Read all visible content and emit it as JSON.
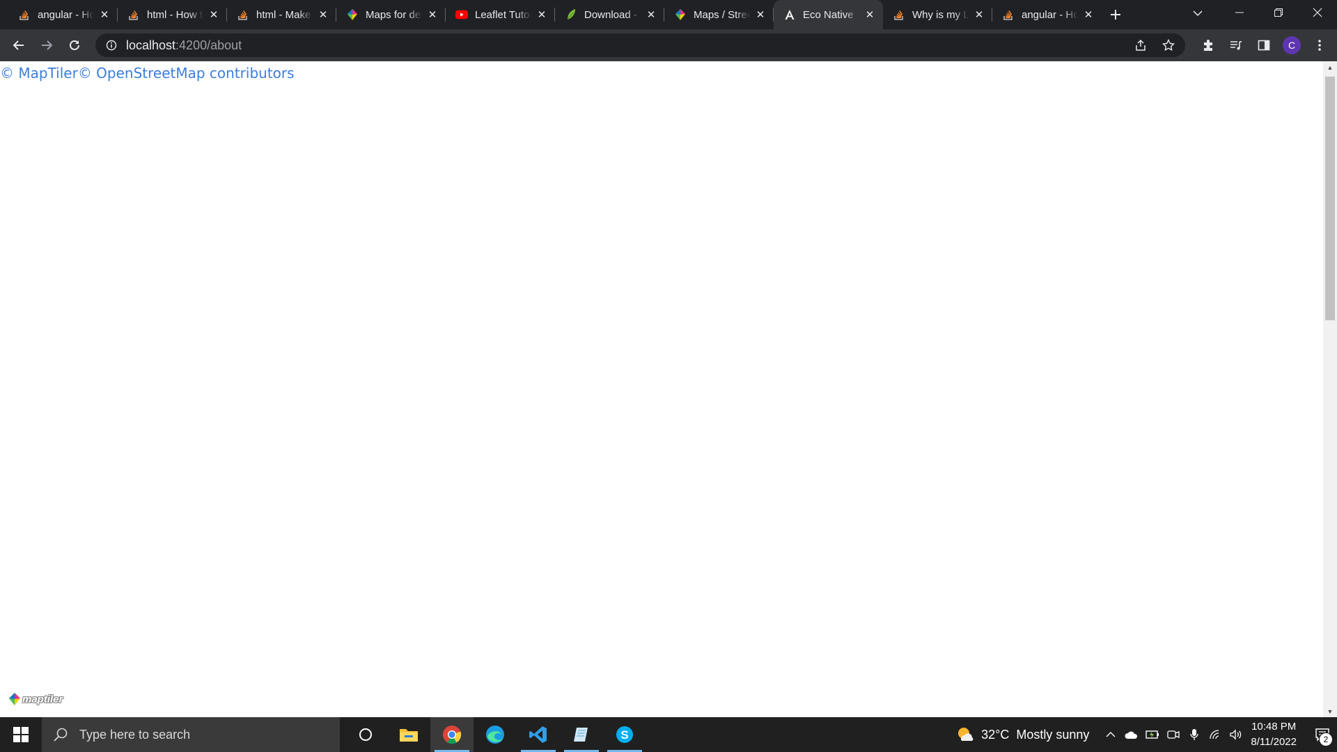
{
  "browser": {
    "tabs": [
      {
        "title": "angular - How to",
        "icon": "stackoverflow-icon",
        "active": false
      },
      {
        "title": "html - How to",
        "icon": "stackoverflow-icon",
        "active": false
      },
      {
        "title": "html - Make",
        "icon": "stackoverflow-icon",
        "active": false
      },
      {
        "title": "Maps for developers",
        "icon": "maptiler-icon",
        "active": false
      },
      {
        "title": "Leaflet Tutorial",
        "icon": "youtube-icon",
        "active": false
      },
      {
        "title": "Download - Leaflet",
        "icon": "leaflet-icon",
        "active": false
      },
      {
        "title": "Maps / Streets",
        "icon": "maptiler-icon",
        "active": false
      },
      {
        "title": "Eco Native",
        "icon": "angular-icon",
        "active": true
      },
      {
        "title": "Why is my Leaflet",
        "icon": "stackoverflow-icon",
        "active": false
      },
      {
        "title": "angular - How",
        "icon": "stackoverflow-icon",
        "active": false
      }
    ],
    "url_host": "localhost",
    "url_path": ":4200/about",
    "profile_initial": "C"
  },
  "page": {
    "attribution_maptiler": "© MapTiler",
    "attribution_osm": "© OpenStreetMap contributors",
    "logo_word": "maptiler"
  },
  "taskbar": {
    "search_placeholder": "Type here to search",
    "weather_temp": "32°C",
    "weather_desc": "Mostly sunny",
    "time": "10:48 PM",
    "date": "8/11/2022",
    "notification_count": "2"
  },
  "colors": {
    "attribution_link": "#3b7ddd",
    "active_tab": "#35363a",
    "tab_strip": "#202124",
    "taskbar": "#202020"
  }
}
